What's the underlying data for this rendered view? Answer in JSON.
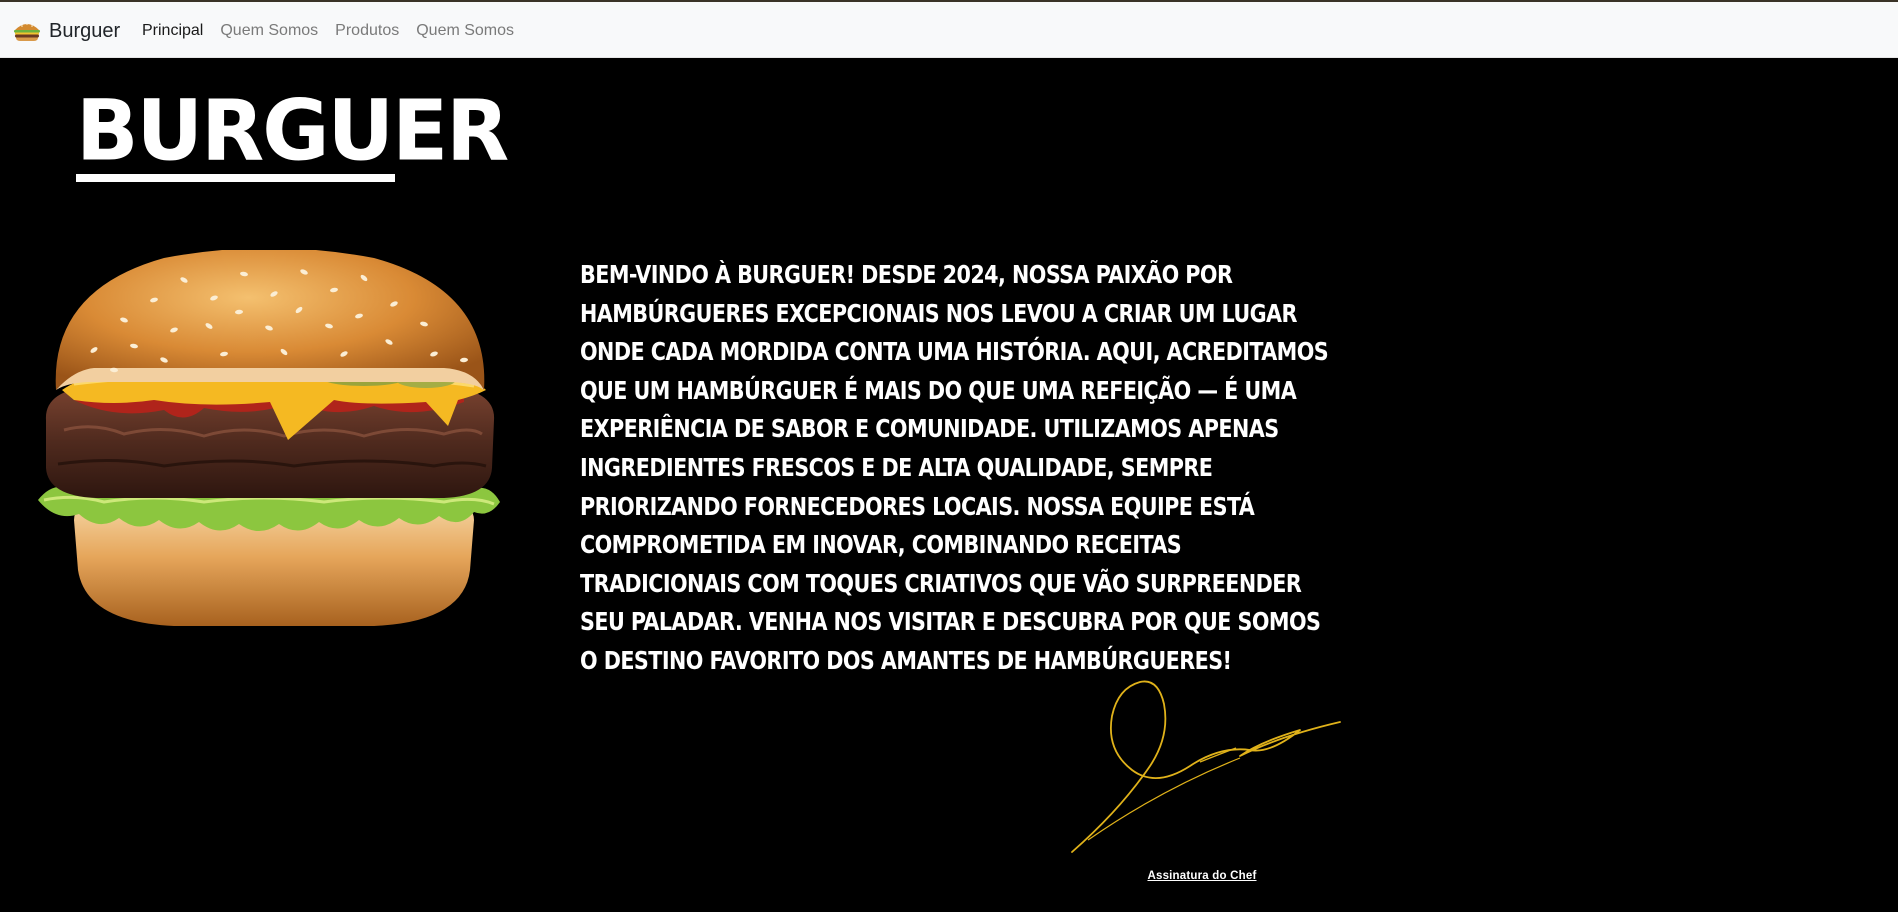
{
  "navbar": {
    "brand_label": "Burguer",
    "brand_icon": "burger-icon",
    "links": [
      {
        "label": "Principal",
        "active": true
      },
      {
        "label": "Quem Somos",
        "active": false
      },
      {
        "label": "Produtos",
        "active": false
      },
      {
        "label": "Quem Somos",
        "active": false
      }
    ]
  },
  "hero": {
    "title": "BURGUER"
  },
  "about": {
    "text": "Bem-vindo à Burguer! Desde 2024, nossa paixão por hambúrgueres excepcionais nos levou a criar um lugar onde cada mordida conta uma história. Aqui, acreditamos que um hambúrguer é mais do que uma refeição — é uma experiência de sabor e comunidade. Utilizamos apenas ingredientes frescos e de alta qualidade, sempre priorizando fornecedores locais. Nossa equipe está comprometida em inovar, combinando receitas tradicionais com toques criativos que vão surpreender seu paladar. Venha nos visitar e descubra por que somos o destino favorito dos amantes de hambúrgueres!"
  },
  "signature": {
    "caption": "Assinatura do Chef",
    "ink_color": "#e0b21a"
  },
  "colors": {
    "background": "#000000",
    "navbar_bg": "#f8f9fa",
    "text": "#ffffff"
  }
}
